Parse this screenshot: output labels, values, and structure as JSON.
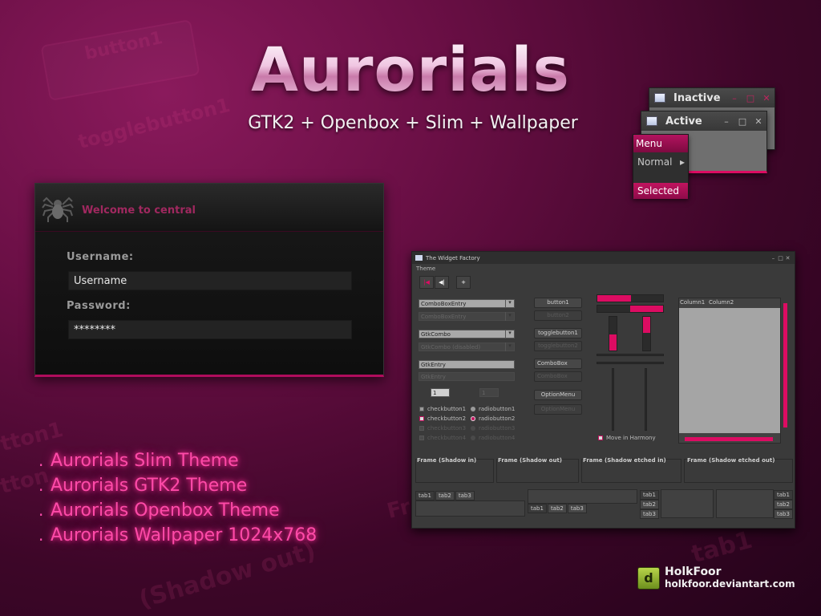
{
  "title": "Aurorials",
  "subtitle": "GTK2 + Openbox + Slim + Wallpaper",
  "background_words": [
    "button1",
    "togglebutton1",
    "button1",
    "tton1",
    "tton",
    "tab1",
    "Fr",
    "(Shadow out)"
  ],
  "slim": {
    "welcome": "Welcome to central",
    "username_label": "Username:",
    "username_value": "Username",
    "password_label": "Password:",
    "password_value": "********",
    "icon": "spider-icon"
  },
  "features": [
    "Aurorials Slim Theme",
    "Aurorials GTK2 Theme",
    "Aurorials Openbox Theme",
    "Aurorials Wallpaper 1024x768"
  ],
  "feature_bullet": ".",
  "openbox": {
    "inactive_title": "Inactive",
    "active_title": "Active",
    "menu_title": "Menu",
    "menu_normal": "Normal",
    "menu_selected": "Selected",
    "window_buttons": [
      "–",
      "□",
      "✕"
    ],
    "submenu_arrow": "▸"
  },
  "widget_factory": {
    "title": "The Widget Factory",
    "menu": "Theme",
    "title_buttons": [
      "–",
      "□",
      "✕"
    ],
    "toolbar": [
      "|◀",
      "◀|",
      "+"
    ],
    "combo_entry": "ComboBoxEntry",
    "combo_entry_dis": "ComboBoxEntry",
    "gtk_combo": "GtkCombo",
    "gtk_combo_dis": "GtkCombo (disabled)",
    "gtk_entry": "GtkEntry",
    "gtk_entry_dis": "GtkEntry",
    "spin_value": "1",
    "spin_value_dis": "1",
    "checks": [
      "checkbutton1",
      "checkbutton2",
      "checkbutton3",
      "checkbutton4"
    ],
    "radios": [
      "radiobutton1",
      "radiobutton2",
      "radiobutton3",
      "radiobutton4"
    ],
    "buttons": [
      "button1",
      "button2",
      "togglebutton1",
      "togglebutton2",
      "ComboBox",
      "ComboBox",
      "OptionMenu",
      "OptionMenu"
    ],
    "move_in_harmony": "Move in Harmony",
    "tree_columns": [
      "Column1",
      "Column2"
    ],
    "frames": [
      "Frame (Shadow in)",
      "Frame (Shadow out)",
      "Frame (Shadow etched in)",
      "Frame (Shadow etched out)"
    ],
    "tabs": [
      "tab1",
      "tab2",
      "tab3"
    ]
  },
  "author": {
    "name": "HolkFoor",
    "site": "holkfoor.deviantart.com",
    "logo_letter": "d"
  },
  "colors": {
    "accent": "#dc0c62",
    "background": "#6a0f45",
    "feature_text": "#ff4aa8"
  }
}
